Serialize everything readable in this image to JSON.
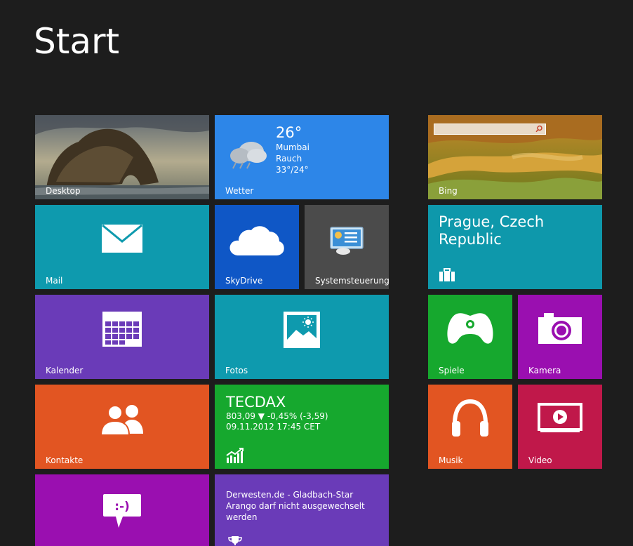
{
  "screen": {
    "title": "Start"
  },
  "tiles": {
    "desktop": {
      "label": "Desktop"
    },
    "weather": {
      "label": "Wetter",
      "temp": "26°",
      "city": "Mumbai",
      "condition": "Rauch",
      "range": "33°/24°"
    },
    "bing": {
      "label": "Bing"
    },
    "mail": {
      "label": "Mail"
    },
    "skydrive": {
      "label": "SkyDrive"
    },
    "control_panel": {
      "label": "Systemsteuerung"
    },
    "travel": {
      "title": "Prague, Czech Republic"
    },
    "calendar": {
      "label": "Kalender"
    },
    "photos": {
      "label": "Fotos"
    },
    "games": {
      "label": "Spiele"
    },
    "camera": {
      "label": "Kamera"
    },
    "contacts": {
      "label": "Kontakte"
    },
    "finance": {
      "title": "TECDAX",
      "quote": "803,09 ▼ -0,45% (-3,59)",
      "timestamp": "09.11.2012 17:45 CET"
    },
    "music": {
      "label": "Musik"
    },
    "video": {
      "label": "Video"
    },
    "messaging": {},
    "news": {
      "headline": "Derwesten.de - Gladbach-Star Arango darf nicht ausgewechselt werden"
    }
  },
  "colors": {
    "background": "#1d1d1d",
    "weather": "#2d86e8",
    "mail": "#0e9aae",
    "skydrive": "#0f57c6",
    "control_panel": "#4b4b4b",
    "travel": "#0e98ab",
    "calendar": "#6a3bb8",
    "photos": "#0e9aae",
    "games": "#16a82e",
    "camera": "#9a0fb0",
    "contacts": "#e25522",
    "finance": "#16a82e",
    "music": "#e25522",
    "video": "#c0184a",
    "messaging": "#9a0fb0",
    "news": "#6a3bb8"
  }
}
